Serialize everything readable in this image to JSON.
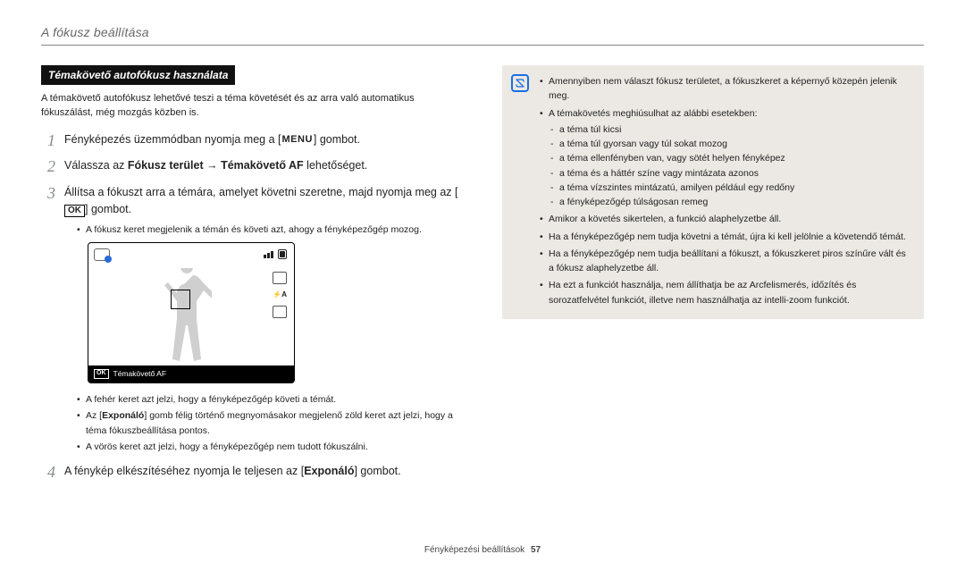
{
  "header_title": "A fókusz beállítása",
  "section_title": "Témakövető autofókusz használata",
  "intro": "A témakövető autofókusz lehetővé teszi a téma követését és az arra való automatikus fókuszálást, még mozgás közben is.",
  "steps": [
    {
      "num": "1",
      "before": "Fényképezés üzemmódban nyomja meg a [",
      "glyph": "MENU",
      "after": "] gombot."
    },
    {
      "num": "2",
      "text_parts": [
        "Válassza az ",
        "Fókusz terület",
        " → ",
        "Témakövető AF",
        " lehetőséget."
      ],
      "bold_idx": [
        1,
        3
      ]
    },
    {
      "num": "3",
      "line1": "Állítsa a fókuszt arra a témára, amelyet követni szeretne, majd nyomja meg az [",
      "glyph": "OK",
      "line1_after": "] gombot.",
      "bullets_top": [
        "A fókusz keret megjelenik a témán és követi azt, ahogy a fényképezőgép mozog."
      ],
      "bullets_bottom": [
        "A fehér keret azt jelzi, hogy a fényképezőgép követi a témát.",
        {
          "before": "Az [",
          "bold": "Exponáló",
          "after": "] gomb félig történő megnyomásakor megjelenő zöld keret azt jelzi, hogy a téma fókuszbeállítása pontos."
        },
        "A vörös keret azt jelzi, hogy a fényképezőgép nem tudott fókuszálni."
      ],
      "display_label": "Témakövető AF"
    },
    {
      "num": "4",
      "before": "A fénykép elkészítéséhez nyomja le teljesen az [",
      "bold": "Exponáló",
      "after": "] gombot."
    }
  ],
  "note": {
    "items": [
      "Amennyiben nem választ fókusz területet, a fókuszkeret a képernyő közepén jelenik meg.",
      {
        "text": "A témakövetés meghiúsulhat az alábbi esetekben:",
        "sub": [
          "a téma túl kicsi",
          "a téma túl gyorsan vagy túl sokat mozog",
          "a téma ellenfényben van, vagy sötét helyen fényképez",
          "a téma és a háttér színe vagy mintázata azonos",
          "a téma vízszintes mintázatú, amilyen például egy redőny",
          "a fényképezőgép túlságosan remeg"
        ]
      },
      "Amikor a követés sikertelen, a funkció alaphelyzetbe áll.",
      "Ha a fényképezőgép nem tudja követni a témát, újra ki kell jelölnie a követendő témát.",
      "Ha a fényképezőgép nem tudja beállítani a fókuszt, a fókuszkeret piros színűre vált és a fókusz alaphelyzetbe áll.",
      "Ha ezt a funkciót használja, nem állíthatja be az Arcfelismerés, időzítés és sorozatfelvétel funkciót, illetve nem használhatja az intelli-zoom funkciót."
    ]
  },
  "footer": {
    "label": "Fényképezési beállítások",
    "page": "57"
  }
}
